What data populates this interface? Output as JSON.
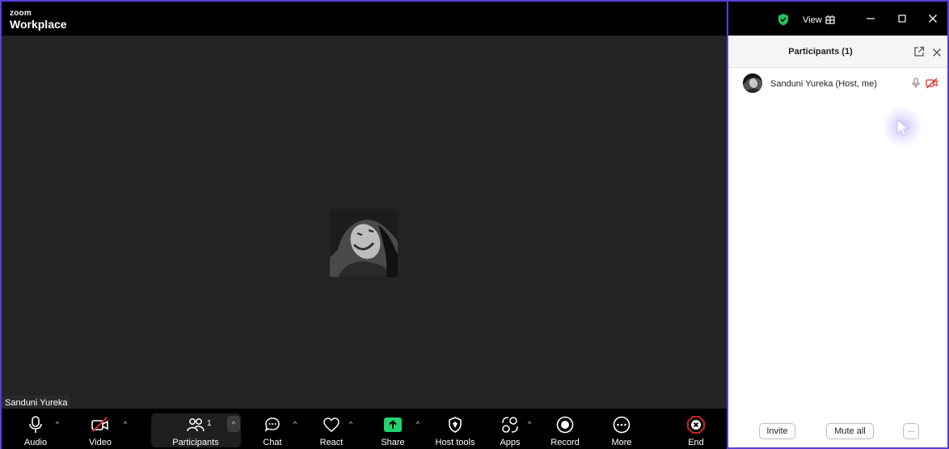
{
  "app": {
    "brand_small": "zoom",
    "brand_large": "Workplace"
  },
  "stage": {
    "name_tag": "Sanduni Yureka"
  },
  "toolbar": {
    "audio": "Audio",
    "video": "Video",
    "participants": "Participants",
    "participants_count": "1",
    "chat": "Chat",
    "react": "React",
    "share": "Share",
    "host_tools": "Host tools",
    "apps": "Apps",
    "record": "Record",
    "more": "More",
    "end": "End"
  },
  "panel": {
    "view_label": "View",
    "title": "Participants (1)",
    "participants": [
      {
        "name": "Sanduni Yureka (Host, me)"
      }
    ],
    "invite": "Invite",
    "mute_all": "Mute all",
    "more": "···"
  },
  "colors": {
    "accent_border": "#5b3fd6",
    "share_green": "#1fd36f",
    "end_red": "#e02828",
    "shield_green": "#22c55e"
  }
}
